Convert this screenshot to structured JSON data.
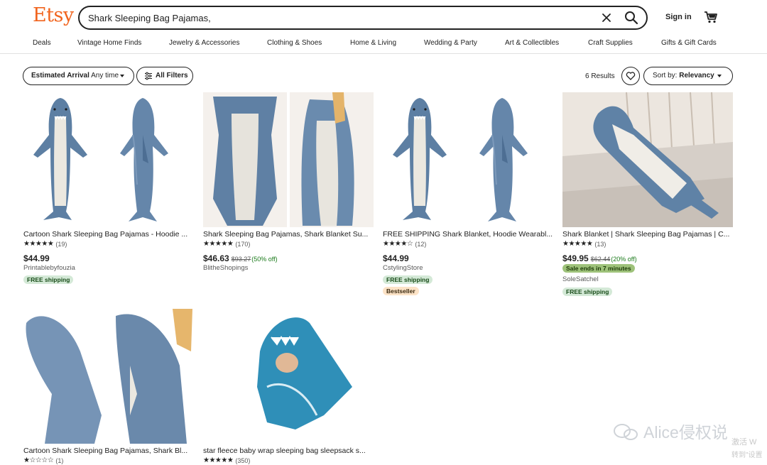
{
  "header": {
    "logo": "Etsy",
    "search_value": "Shark Sleeping Bag Pajamas,",
    "signin": "Sign in"
  },
  "nav": [
    "Deals",
    "Vintage Home Finds",
    "Jewelry & Accessories",
    "Clothing & Shoes",
    "Home & Living",
    "Wedding & Party",
    "Art & Collectibles",
    "Craft Supplies",
    "Gifts & Gift Cards"
  ],
  "filters": {
    "arrival_label": "Estimated Arrival",
    "arrival_value": "Any time",
    "all_filters": "All Filters",
    "results": "6 Results",
    "sort_label": "Sort by:",
    "sort_value": "Relevancy"
  },
  "products": [
    {
      "title": "Cartoon Shark Sleeping Bag Pajamas - Hoodie ...",
      "stars": "★★★★★",
      "rating": 4.5,
      "count": "(19)",
      "price": "$44.99",
      "original_price": "",
      "discount": "",
      "shop": "Printablebyfouzia",
      "badges": [
        "FREE shipping"
      ]
    },
    {
      "title": "Shark Sleeping Bag Pajamas, Shark Blanket Su...",
      "stars": "★★★★★",
      "rating": 4.5,
      "count": "(170)",
      "price": "$46.63",
      "original_price": "$93.27",
      "discount": "(50% off)",
      "shop": "BlitheShopings",
      "badges": []
    },
    {
      "title": "FREE SHIPPING Shark Blanket, Hoodie Wearabl...",
      "stars": "★★★★☆",
      "rating": 3.5,
      "count": "(12)",
      "price": "$44.99",
      "original_price": "",
      "discount": "",
      "shop": "CstylingStore",
      "badges": [
        "FREE shipping",
        "Bestseller"
      ]
    },
    {
      "title": "Shark Blanket | Shark Sleeping Bag Pajamas | C...",
      "stars": "★★★★★",
      "rating": 5,
      "count": "(13)",
      "price": "$49.95",
      "original_price": "$62.44",
      "discount": "(20% off)",
      "sale": "Sale ends in 7 minutes",
      "shop": "SoleSatchel",
      "badges": [
        "FREE shipping"
      ]
    },
    {
      "title": "Cartoon Shark Sleeping Bag Pajamas, Shark Bl...",
      "stars": "★☆☆☆☆",
      "rating": 1,
      "count": "(1)"
    },
    {
      "title": "star fleece baby wrap sleeping bag sleepsack s...",
      "stars": "★★★★★",
      "rating": 5,
      "count": "(350)"
    }
  ],
  "watermark": {
    "text": "Alice侵权说",
    "activate": "激活 W",
    "activate2": "转到\"设置"
  },
  "colors": {
    "brand": "#f1641e",
    "shark_blue": "#5d7fa3",
    "belly": "#e8e6e0"
  }
}
